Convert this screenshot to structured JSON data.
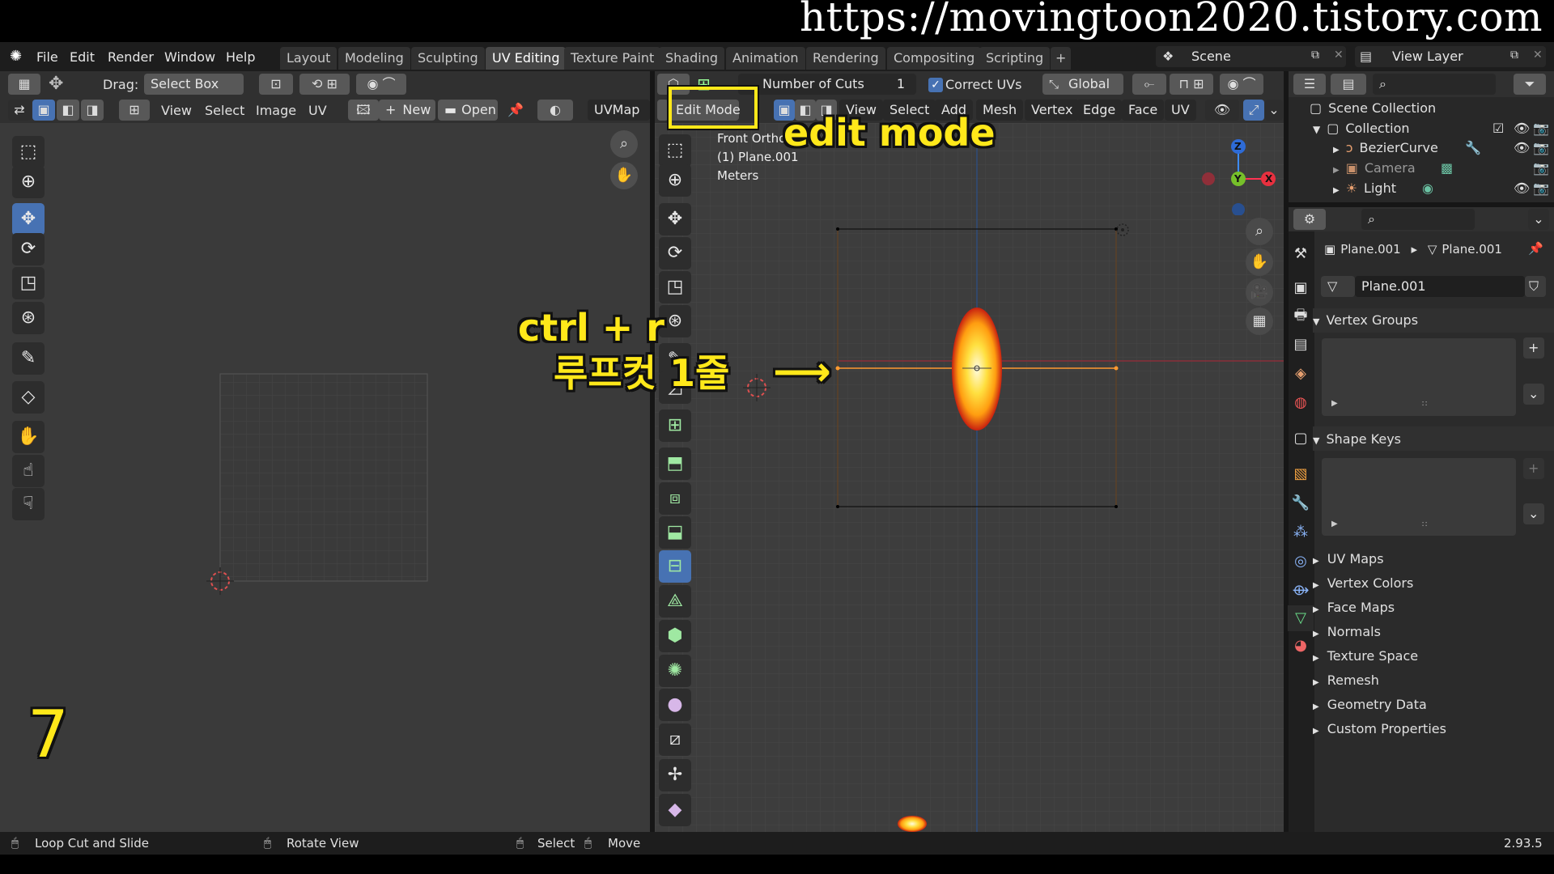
{
  "watermark": "https://movingtoon2020.tistory.com",
  "menu": {
    "file": "File",
    "edit": "Edit",
    "render": "Render",
    "window": "Window",
    "help": "Help"
  },
  "workspaces": [
    "Layout",
    "Modeling",
    "Sculpting",
    "UV Editing",
    "Texture Paint",
    "Shading",
    "Animation",
    "Rendering",
    "Compositing",
    "Scripting"
  ],
  "active_workspace": "UV Editing",
  "add_tab": "+",
  "scene": "Scene",
  "view_layer": "View Layer",
  "uv_editor": {
    "drag_label": "Drag:",
    "drag_mode": "Select Box",
    "menus": [
      "View",
      "Select",
      "Image",
      "UV"
    ],
    "new_label": "New",
    "open_label": "Open",
    "uvmap": "UVMap"
  },
  "viewport": {
    "operator_field": "Number of Cuts",
    "operator_value": "1",
    "correct_uvs": "Correct UVs",
    "transform_orientation": "Global",
    "mode": "Edit Mode",
    "menus": [
      "View",
      "Select",
      "Add",
      "Mesh",
      "Vertex",
      "Edge",
      "Face",
      "UV"
    ],
    "view_name": "Front Orthographic",
    "object_label": "(1) Plane.001",
    "units": "Meters",
    "gizmo": {
      "z": "Z",
      "y": "Y",
      "x": "X"
    }
  },
  "outliner": {
    "scene_collection": "Scene Collection",
    "collection": "Collection",
    "items": [
      "BezierCurve",
      "Camera",
      "Light"
    ]
  },
  "properties": {
    "breadcrumb_object": "Plane.001",
    "breadcrumb_mesh": "Plane.001",
    "mesh_name": "Plane.001",
    "sections_open": [
      "Vertex Groups",
      "Shape Keys"
    ],
    "sections_closed": [
      "UV Maps",
      "Vertex Colors",
      "Face Maps",
      "Normals",
      "Texture Space",
      "Remesh",
      "Geometry Data",
      "Custom Properties"
    ]
  },
  "annotations": {
    "edit_mode": "edit mode",
    "shortcut": "ctrl + r",
    "loopcut": "루프컷 1줄",
    "arrow": "⟶",
    "step": "7"
  },
  "statusbar": {
    "left": "Loop Cut and Slide",
    "middle": "Rotate View",
    "select": "Select",
    "move": "Move",
    "version": "2.93.5"
  },
  "colors": {
    "accent": "#4772b3",
    "annotation": "#ffe81a",
    "selected_edge": "#ffa033"
  }
}
